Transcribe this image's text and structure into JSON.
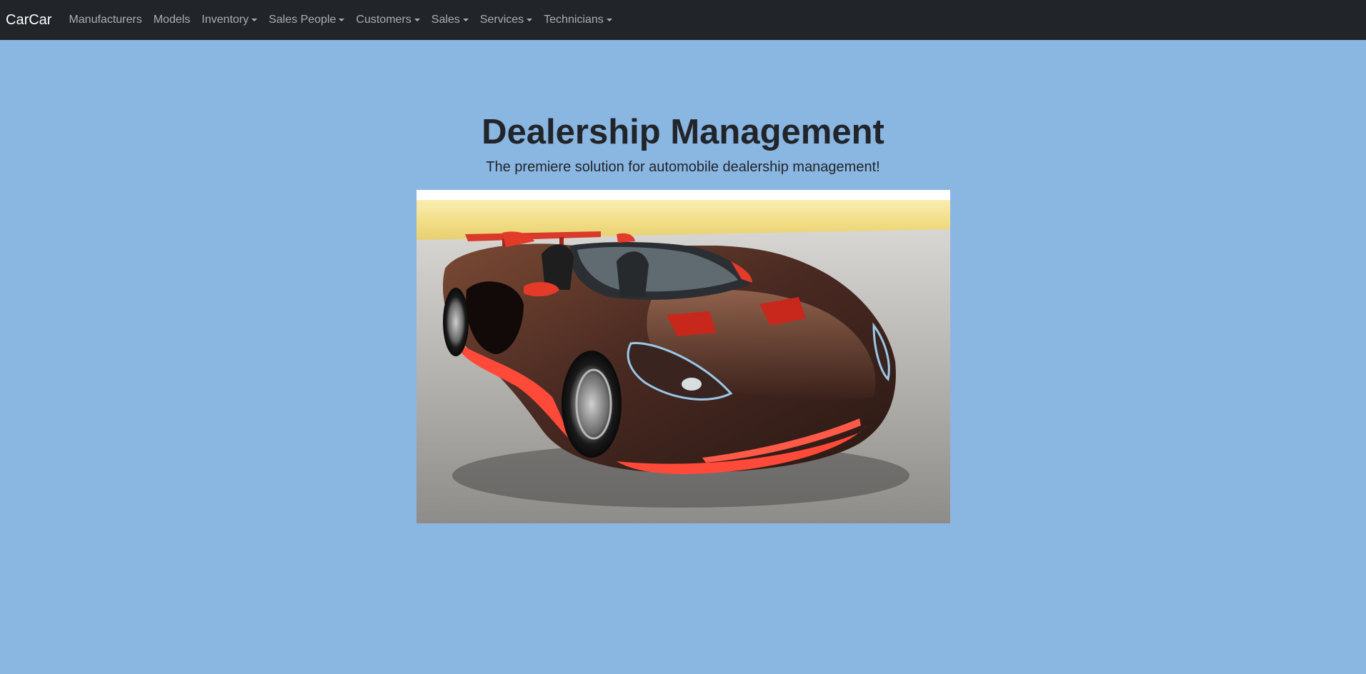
{
  "navbar": {
    "brand": "CarCar",
    "items": [
      {
        "label": "Manufacturers",
        "dropdown": false
      },
      {
        "label": "Models",
        "dropdown": false
      },
      {
        "label": "Inventory",
        "dropdown": true
      },
      {
        "label": "Sales People",
        "dropdown": true
      },
      {
        "label": "Customers",
        "dropdown": true
      },
      {
        "label": "Sales",
        "dropdown": true
      },
      {
        "label": "Services",
        "dropdown": true
      },
      {
        "label": "Technicians",
        "dropdown": true
      }
    ]
  },
  "hero": {
    "title": "Dealership Management",
    "subtitle": "The premiere solution for automobile dealership management!"
  },
  "colors": {
    "navbar_bg": "#212529",
    "page_bg": "#8ab6e2",
    "car_body": "#4a2a22",
    "car_accent": "#ff4a3a"
  }
}
